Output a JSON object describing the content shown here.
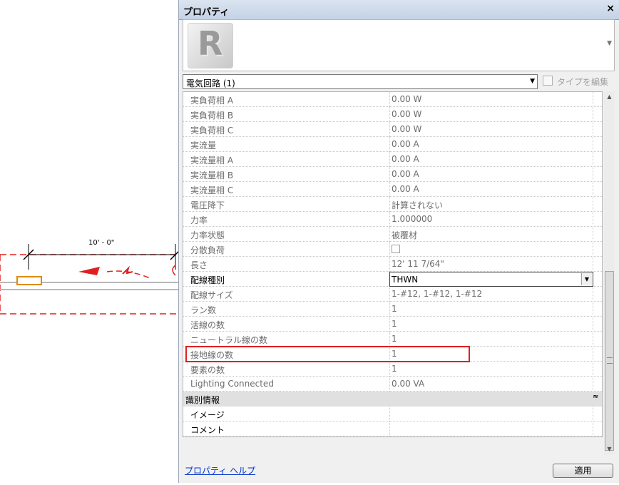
{
  "drawing": {
    "dimension_text": "10' - 0\""
  },
  "panel": {
    "title": "プロパティ",
    "close_label": "×"
  },
  "type_selector": {
    "label": "電気回路 (1)",
    "edit_type_label": "タイプを編集"
  },
  "properties": [
    {
      "name": "実負荷相 A",
      "value": "0.00 W"
    },
    {
      "name": "実負荷相 B",
      "value": "0.00 W"
    },
    {
      "name": "実負荷相 C",
      "value": "0.00 W"
    },
    {
      "name": "実流量",
      "value": "0.00 A"
    },
    {
      "name": "実流量相 A",
      "value": "0.00 A"
    },
    {
      "name": "実流量相 B",
      "value": "0.00 A"
    },
    {
      "name": "実流量相 C",
      "value": "0.00 A"
    },
    {
      "name": "電圧降下",
      "value": "計算されない"
    },
    {
      "name": "力率",
      "value": "1.000000"
    },
    {
      "name": "力率状態",
      "value": "被覆材"
    },
    {
      "name": "分散負荷",
      "value": ""
    },
    {
      "name": "長さ",
      "value": "12'  11 7/64\""
    },
    {
      "name": "配線種別",
      "value": "THWN"
    },
    {
      "name": "配線サイズ",
      "value": "1-#12, 1-#12, 1-#12"
    },
    {
      "name": "ラン数",
      "value": "1"
    },
    {
      "name": "活線の数",
      "value": "1"
    },
    {
      "name": "ニュートラル線の数",
      "value": "1"
    },
    {
      "name": "接地線の数",
      "value": "1"
    },
    {
      "name": "要素の数",
      "value": "1"
    },
    {
      "name": "Lighting Connected",
      "value": "0.00 VA"
    }
  ],
  "identity_group": {
    "title": "識別情報",
    "rows": [
      {
        "name": "イメージ",
        "value": ""
      },
      {
        "name": "コメント",
        "value": ""
      }
    ]
  },
  "footer": {
    "help_link": "プロパティ ヘルプ",
    "apply_label": "適用"
  },
  "colors": {
    "highlight": "#e02020",
    "dim_lines": "#e02020",
    "link": "#0033cc"
  }
}
